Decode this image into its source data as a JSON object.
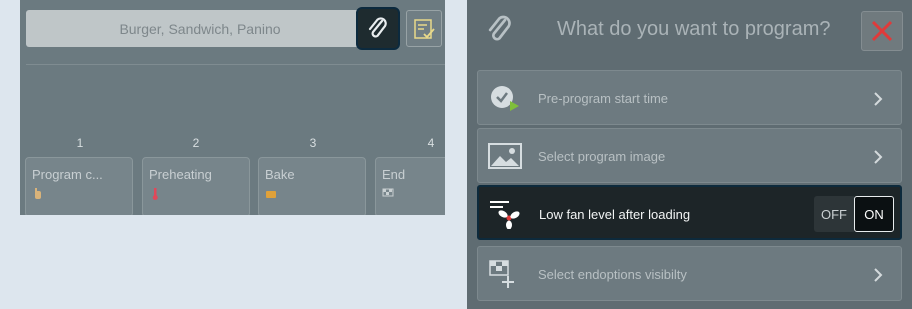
{
  "left_panel": {
    "program_name": "Burger, Sandwich, Panino",
    "steps": [
      {
        "number": "1",
        "label": "Program c...",
        "icon": "hand-icon"
      },
      {
        "number": "2",
        "label": "Preheating",
        "icon": "thermometer-icon"
      },
      {
        "number": "3",
        "label": "Bake",
        "icon": "bake-icon"
      },
      {
        "number": "4",
        "label": "End",
        "icon": "checkered-flag-icon"
      }
    ]
  },
  "dialog": {
    "title": "What do you want to program?",
    "options": [
      {
        "label": "Pre-program start time"
      },
      {
        "label": "Select program image"
      },
      {
        "label": "Low fan level after loading",
        "toggle_off": "OFF",
        "toggle_on": "ON",
        "toggle_state": "ON"
      },
      {
        "label": "Select endoptions visibilty"
      }
    ]
  },
  "colors": {
    "accent_close": "#e03a3a",
    "selected_border": "#0d2a3c",
    "step_thermometer": "#e0485a",
    "step_bake": "#e0a13a"
  }
}
